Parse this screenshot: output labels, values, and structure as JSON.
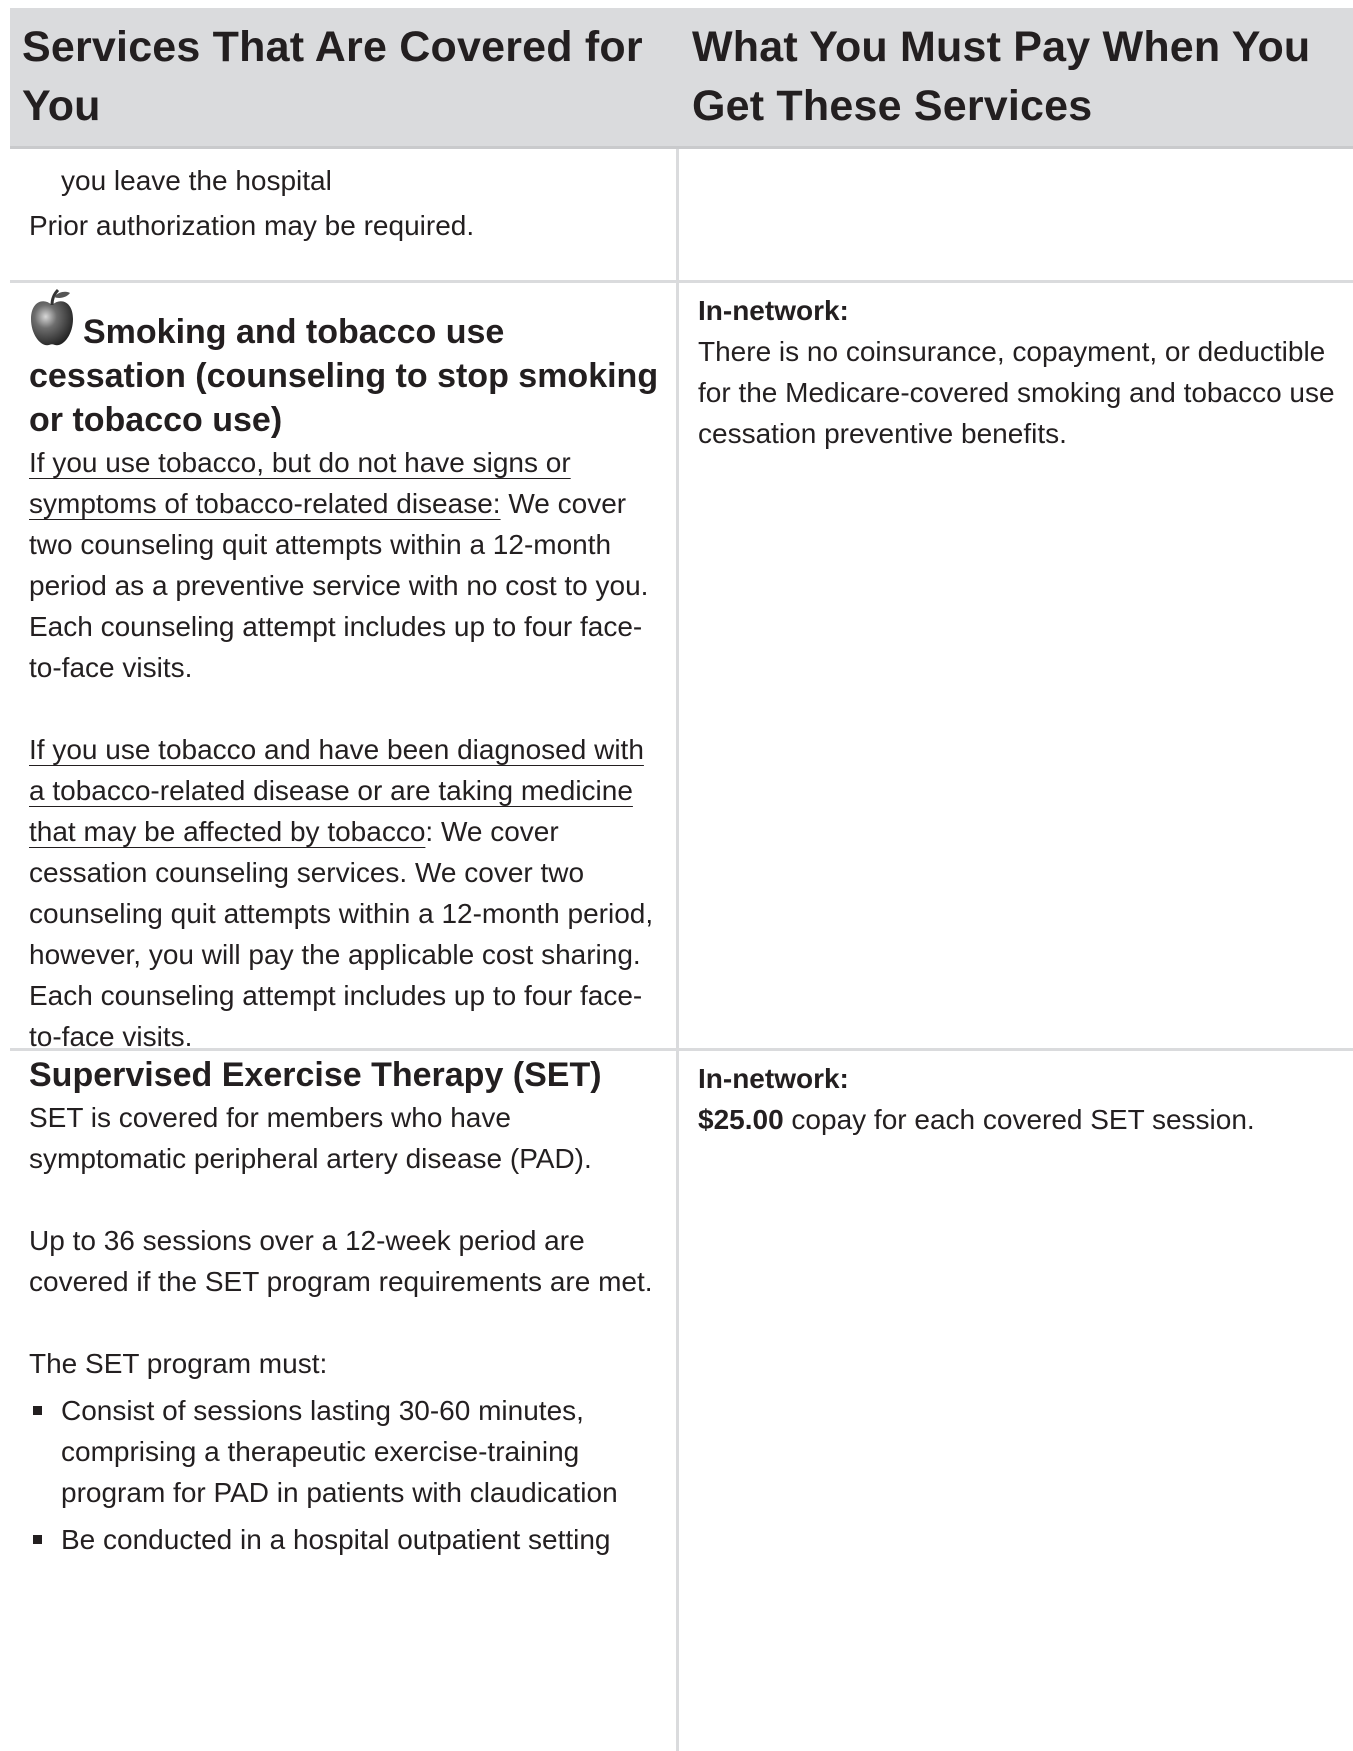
{
  "header": {
    "col1": "Services That Are Covered for You",
    "col2": "What You Must Pay When You Get These Services"
  },
  "row0": {
    "line1": "you leave the hospital",
    "line2": "Prior authorization may be required."
  },
  "smoking": {
    "icon": "apple-icon",
    "title": "Smoking and tobacco use cessation (counseling to stop smoking or tobacco use)",
    "p1_condition": "If you use tobacco, but do not have signs or symptoms of tobacco-related disease:",
    "p1_text": " We cover two counseling quit attempts within a 12-month period as a preventive service with no cost to you. Each counseling attempt includes up to four face-to-face visits.",
    "p2_condition": "If you use tobacco and have been diagnosed with a tobacco-related disease or are taking medicine that may be affected by tobacco",
    "p2_text": ": We cover cessation counseling services. We cover two counseling quit attempts within a 12-month period, however, you will pay the applicable cost sharing. Each counseling attempt includes up to four face-to-face visits.",
    "in_network_label": "In-network:",
    "cost_text": "There is no coinsurance, copayment, or deductible for the Medicare-covered smoking and tobacco use cessation preventive benefits."
  },
  "set": {
    "title": "Supervised Exercise Therapy (SET)",
    "p1": "SET is covered for members who have symptomatic peripheral artery disease (PAD).",
    "p2": "Up to 36 sessions over a 12-week period are covered if the SET program requirements are met.",
    "p3": "The SET program must:",
    "bullets": [
      "Consist of sessions lasting 30-60 minutes, comprising a therapeutic exercise-training program for PAD in patients with claudication",
      "Be conducted in a hospital outpatient setting"
    ],
    "in_network_label": "In-network:",
    "copay_amount": "$25.00",
    "copay_text": " copay for each covered SET session."
  }
}
